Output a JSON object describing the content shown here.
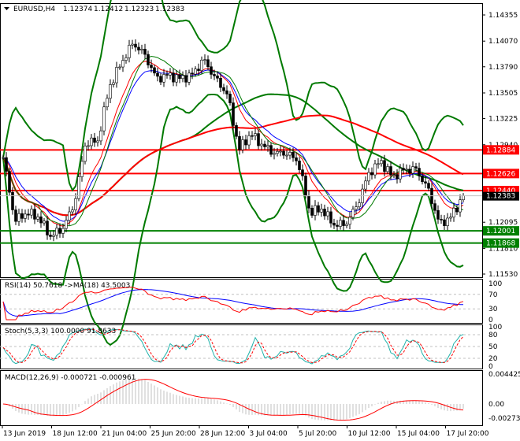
{
  "header": {
    "symbol": "EURUSD,H4",
    "open": "1.12374",
    "high": "1.12412",
    "low": "1.12323",
    "close": "1.12383"
  },
  "colors": {
    "bull": "#000000",
    "bear": "#000000",
    "bands": "#007a00",
    "ma_fast": "#ff0000",
    "ma_mid": "#0000ff",
    "ma_slow": "#007a00",
    "resistance": "#ff0000",
    "support": "#008000",
    "rsi": "#ff0000",
    "rsi_ma": "#0000ff",
    "stoch_main": "#20b2aa",
    "stoch_signal": "#ff0000",
    "macd_hist": "#c0c0c0",
    "macd_signal": "#ff0000"
  },
  "chart_data": [
    {
      "type": "candlestick",
      "symbol": "EURUSD",
      "timeframe": "H4",
      "ylim": [
        1.1153,
        1.14355
      ],
      "price_ticks": [
        "1.14355",
        "1.14070",
        "1.13790",
        "1.13505",
        "1.13225",
        "1.12940",
        "1.12095",
        "1.11810",
        "1.11530"
      ],
      "time_labels": [
        "13 Jun 2019",
        "18 Jun 12:00",
        "21 Jun 04:00",
        "25 Jun 20:00",
        "28 Jun 12:00",
        "3 Jul 04:00",
        "5 Jul 20:00",
        "10 Jul 12:00",
        "15 Jul 04:00",
        "17 Jul 20:00"
      ],
      "close_path": [
        1.128,
        1.1211,
        1.122,
        1.1215,
        1.1194,
        1.1202,
        1.1228,
        1.1297,
        1.1297,
        1.1357,
        1.1383,
        1.1405,
        1.1392,
        1.1366,
        1.137,
        1.1366,
        1.137,
        1.1387,
        1.1366,
        1.1349,
        1.1289,
        1.1306,
        1.1293,
        1.1285,
        1.1285,
        1.1276,
        1.122,
        1.1224,
        1.1207,
        1.1207,
        1.1228,
        1.1263,
        1.1276,
        1.1259,
        1.1267,
        1.1267,
        1.1246,
        1.1207,
        1.1216,
        1.12383
      ],
      "levels": [
        {
          "value": "1.12884",
          "kind": "resistance"
        },
        {
          "value": "1.12626",
          "kind": "resistance"
        },
        {
          "value": "1.12440",
          "kind": "resistance"
        },
        {
          "value": "1.12001",
          "kind": "support"
        },
        {
          "value": "1.11868",
          "kind": "support"
        }
      ],
      "current_price": "1.12383"
    },
    {
      "type": "line",
      "name": "RSI(14) 50.7618  ->MA(18) 43.5003",
      "ylim": [
        0,
        100
      ],
      "ticks": [
        "100",
        "70",
        "30",
        "0"
      ]
    },
    {
      "type": "line",
      "name": "Stoch(5,3,3) 100.0000 91.8633",
      "ylim": [
        0,
        100
      ],
      "ticks": [
        "100",
        "80",
        "50",
        "20",
        "0"
      ]
    },
    {
      "type": "bar",
      "name": "MACD(12,26,9) -0.000721 -0.000961",
      "ticks": [
        "0.004425",
        "0.00",
        "-0.002736"
      ]
    }
  ]
}
